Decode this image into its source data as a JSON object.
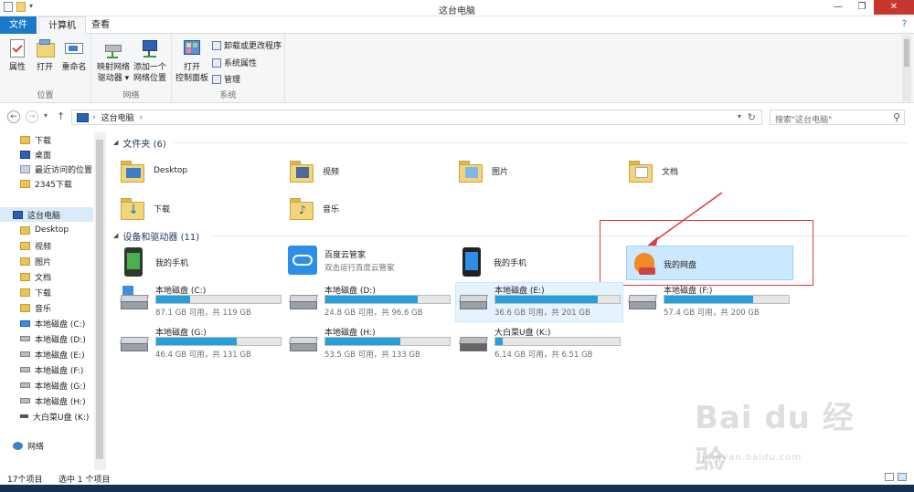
{
  "window": {
    "title": "这台电脑"
  },
  "quick_access": [
    {
      "icon": "properties-icon",
      "color": "#5a7ab0"
    },
    {
      "icon": "new-folder-icon",
      "color": "#e6c15a"
    },
    {
      "icon": "qa-dropdown-icon",
      "color": "#777777"
    }
  ],
  "window_controls": {
    "minimize": "—",
    "maximize": "❐",
    "close": "✕"
  },
  "tabs": [
    {
      "label": "文件",
      "active": false
    },
    {
      "label": "计算机",
      "active": true
    },
    {
      "label": "查看",
      "active": false
    }
  ],
  "help_glyph": "?",
  "ribbon": {
    "groups": [
      {
        "name": "位置",
        "buttons": [
          {
            "label": "属性",
            "icon": "properties-check-icon"
          },
          {
            "label": "打开",
            "icon": "open-folder-icon"
          },
          {
            "label": "重命名",
            "icon": "rename-icon"
          }
        ]
      },
      {
        "name": "网络",
        "buttons": [
          {
            "label": "映射网络\n驱动器 ▾",
            "icon": "map-drive-icon"
          },
          {
            "label": "添加一个\n网络位置",
            "icon": "network-location-icon"
          }
        ]
      },
      {
        "name": "系统",
        "buttons": [
          {
            "label": "打开\n控制面板",
            "icon": "control-panel-icon"
          }
        ],
        "small": [
          {
            "label": "卸载或更改程序",
            "icon": "uninstall-icon"
          },
          {
            "label": "系统属性",
            "icon": "system-properties-icon"
          },
          {
            "label": "管理",
            "icon": "manage-icon"
          }
        ]
      }
    ]
  },
  "address": {
    "crumb": "这台电脑",
    "arrow": "›",
    "search_placeholder": "搜索\"这台电脑\"",
    "back": "←",
    "forward": "→",
    "dropdown": "▾",
    "up": "↑",
    "refresh": "↻",
    "search_glyph": "⚲"
  },
  "nav_pane": {
    "quick": [
      "下载",
      "桌面",
      "最近访问的位置",
      "2345下载"
    ],
    "this_pc": "这台电脑",
    "pc_items": [
      "Desktop",
      "视频",
      "图片",
      "文档",
      "下载",
      "音乐",
      "本地磁盘 (C:)",
      "本地磁盘 (D:)",
      "本地磁盘 (E:)",
      "本地磁盘 (F:)",
      "本地磁盘 (G:)",
      "本地磁盘 (H:)",
      "大白菜U盘 (K:)"
    ],
    "network": "网络"
  },
  "folders_section": {
    "label": "文件夹 (6)",
    "items": [
      "Desktop",
      "视频",
      "图片",
      "文档",
      "下载",
      "音乐"
    ]
  },
  "devices_section": {
    "label": "设备和驱动器 (11)",
    "devices": [
      {
        "name": "我的手机"
      },
      {
        "name": "百度云管家",
        "sub": "双击运行百度云管家"
      },
      {
        "name": "我的手机"
      },
      {
        "name": "我的网盘"
      }
    ],
    "drives": [
      {
        "name": "本地磁盘 (C:)",
        "info": "87.1 GB 可用，共 119 GB",
        "used": 0.27
      },
      {
        "name": "本地磁盘 (D:)",
        "info": "24.8 GB 可用，共 96.6 GB",
        "used": 0.74
      },
      {
        "name": "本地磁盘 (E:)",
        "info": "36.6 GB 可用，共 201 GB",
        "used": 0.82
      },
      {
        "name": "本地磁盘 (F:)",
        "info": "57.4 GB 可用，共 200 GB",
        "used": 0.71
      },
      {
        "name": "本地磁盘 (G:)",
        "info": "46.4 GB 可用，共 131 GB",
        "used": 0.65
      },
      {
        "name": "本地磁盘 (H:)",
        "info": "53.5 GB 可用，共 133 GB",
        "used": 0.6
      },
      {
        "name": "大白菜U盘 (K:)",
        "info": "6.14 GB 可用，共 6.51 GB",
        "used": 0.06
      }
    ]
  },
  "status": {
    "count": "17个项目",
    "selected": "选中 1 个项目"
  },
  "watermark": {
    "brand": "Bai du 经验",
    "url": "jingyan.baidu.com"
  },
  "colors": {
    "accent": "#1979ca",
    "bar": "#26a0da",
    "annotation": "#e03a3a"
  }
}
